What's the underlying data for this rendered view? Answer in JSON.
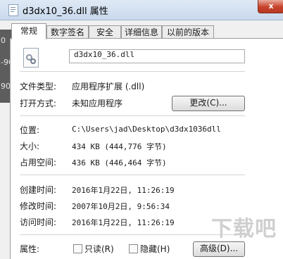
{
  "window": {
    "title": "d3dx10_36.dll 属性",
    "close_label": "x"
  },
  "strip": {
    "numbers": [
      "0",
      "-90",
      "90"
    ]
  },
  "tabs": [
    {
      "label": "常规"
    },
    {
      "label": "数字签名"
    },
    {
      "label": "安全"
    },
    {
      "label": "详细信息"
    },
    {
      "label": "以前的版本"
    }
  ],
  "general": {
    "filename": "d3dx10_36.dll",
    "file_type_label": "文件类型:",
    "file_type_value": "应用程序扩展 (.dll)",
    "open_with_label": "打开方式:",
    "open_with_value": "未知应用程序",
    "change_button": "更改(C)...",
    "location_label": "位置:",
    "location_value": "C:\\Users\\jad\\Desktop\\d3dx1036dll",
    "size_label": "大小:",
    "size_value": "434 KB (444,776 字节)",
    "size_on_disk_label": "占用空间:",
    "size_on_disk_value": "436 KB (446,464 字节)",
    "created_label": "创建时间:",
    "created_value": "2016年1月22日, 11:26:19",
    "modified_label": "修改时间:",
    "modified_value": "2007年10月2日, 9:56:34",
    "accessed_label": "访问时间:",
    "accessed_value": "2016年1月22日, 11:26:19",
    "attributes_label": "属性:",
    "readonly_label": "只读(R)",
    "hidden_label": "隐藏(H)",
    "advanced_button": "高级(D)..."
  },
  "watermark": {
    "text": "下载吧"
  }
}
